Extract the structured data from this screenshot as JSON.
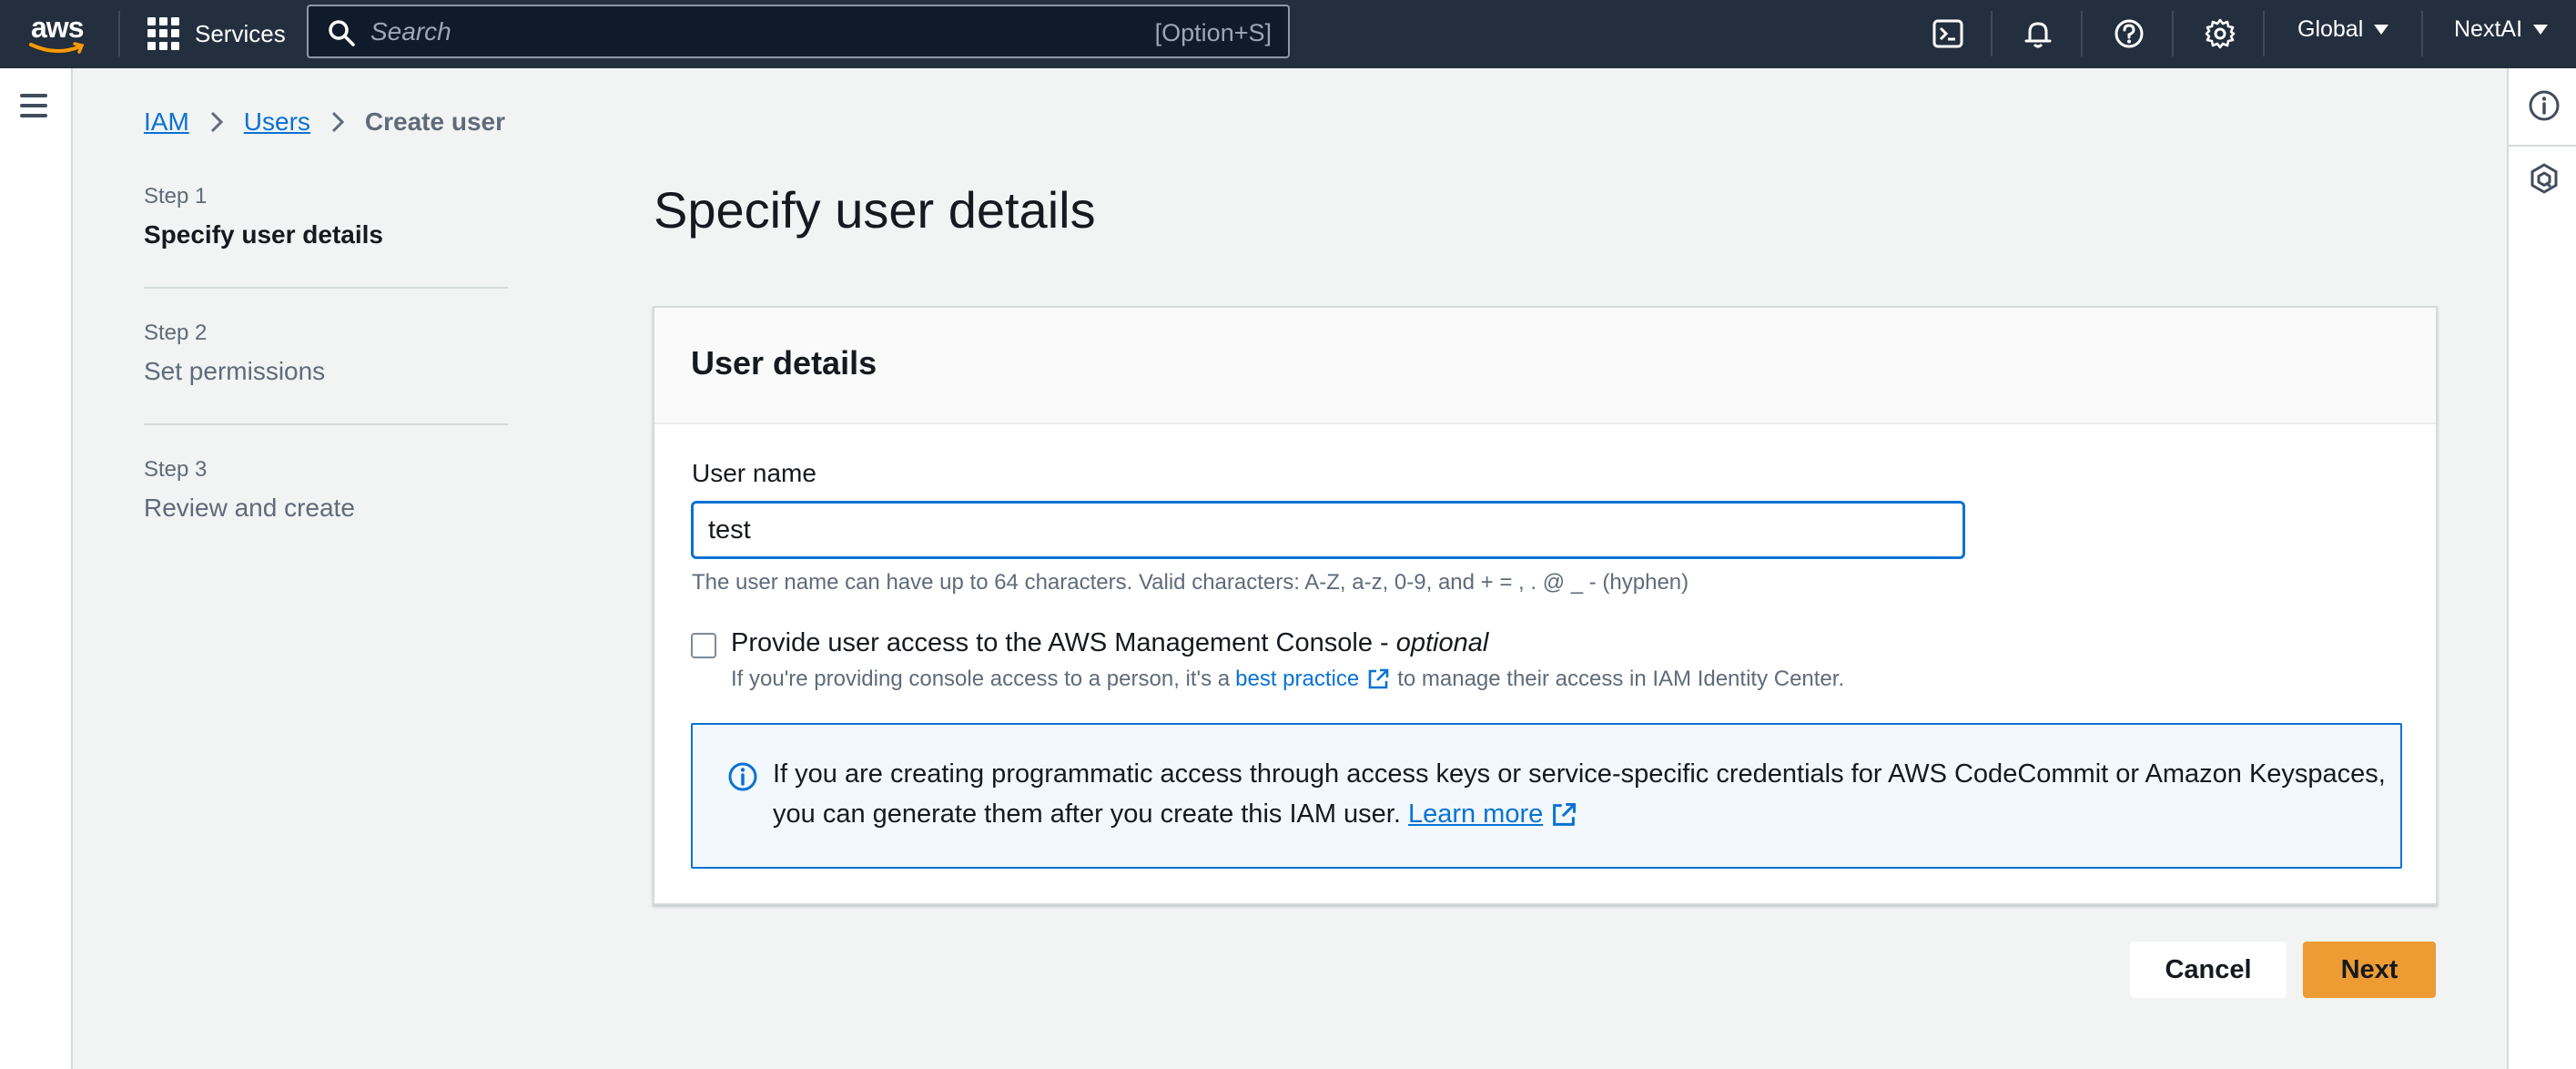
{
  "topnav": {
    "logo_text": "aws",
    "services_label": "Services",
    "search_placeholder": "Search",
    "search_shortcut": "[Option+S]",
    "region_label": "Global",
    "account_label": "NextAI",
    "icons": [
      "cloudshell-icon",
      "notifications-icon",
      "help-icon",
      "settings-icon"
    ]
  },
  "breadcrumb": {
    "items": [
      "IAM",
      "Users"
    ],
    "current": "Create user"
  },
  "steps": [
    {
      "num": "Step 1",
      "title": "Specify user details",
      "active": true
    },
    {
      "num": "Step 2",
      "title": "Set permissions",
      "active": false
    },
    {
      "num": "Step 3",
      "title": "Review and create",
      "active": false
    }
  ],
  "page": {
    "title": "Specify user details"
  },
  "panel": {
    "header": "User details",
    "username_label": "User name",
    "username_value": "test",
    "username_constraint": "The user name can have up to 64 characters. Valid characters: A-Z, a-z, 0-9, and + = , . @ _ - (hyphen)",
    "console_access_label": "Provide user access to the AWS Management Console - ",
    "console_access_optional": "optional",
    "console_access_checked": false,
    "console_desc_before": "If you're providing console access to a person, it's a",
    "console_desc_link": "best practice",
    "console_desc_after": "to manage their access in IAM Identity Center.",
    "info_line1": "If you are creating programmatic access through access keys or service-specific credentials for AWS CodeCommit or Amazon Keyspaces,",
    "info_line2": "you can generate them after you create this IAM user.",
    "info_link": "Learn more"
  },
  "actions": {
    "cancel_label": "Cancel",
    "next_label": "Next"
  },
  "colors": {
    "nav_bg": "#232f3e",
    "link": "#0972d3",
    "primary_button": "#ec9c32",
    "page_bg": "#f2f3f3",
    "info_bg": "#f2f8fd",
    "aws_smile": "#ff9900"
  }
}
